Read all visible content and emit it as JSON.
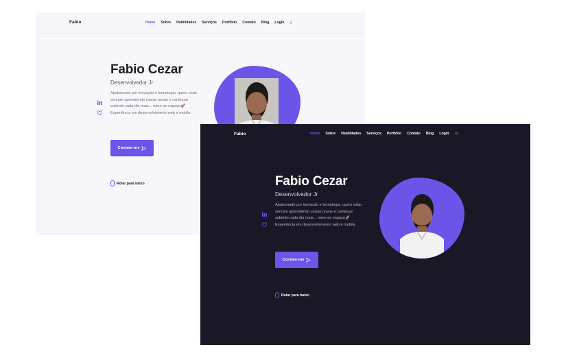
{
  "nav": {
    "logo": "Fabio",
    "items": [
      "Home",
      "Sobre",
      "Habilidades",
      "Serviços",
      "Portfólio",
      "Contato",
      "Blog",
      "Login"
    ]
  },
  "hero": {
    "name": "Fabio Cezar",
    "role": "Desenvolvedor Jr",
    "description": "Apaixonado por inovação e tecnologia, quero estar sempre aprendendo coisas novas e continuar subindo cada dia mais... rumo ao espaço🚀 Experiência em desenvolvimento web e mobile.",
    "cta": "Contate-me",
    "scroll": "Rolar para baixo"
  },
  "colors": {
    "accent": "#6a55e8",
    "dark_bg": "#1a1726",
    "light_bg": "#f7f6fb"
  },
  "icons": {
    "linkedin": "linkedin-icon",
    "github": "github-icon",
    "send": "send-icon",
    "mouse": "mouse-icon"
  }
}
